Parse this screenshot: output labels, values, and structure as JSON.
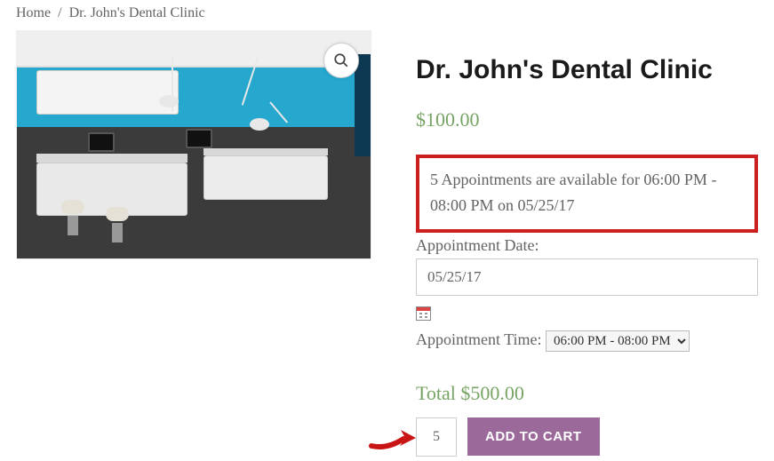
{
  "breadcrumb": {
    "home": "Home",
    "current": "Dr. John's Dental Clinic"
  },
  "product": {
    "title": "Dr. John's Dental Clinic",
    "price": "$100.00",
    "availability": "5 Appointments are available for 06:00 PM - 08:00 PM on 05/25/17",
    "date_label": "Appointment Date:",
    "date_value": "05/25/17",
    "time_label": "Appointment Time:",
    "time_value": "06:00 PM - 08:00 PM",
    "total_label": "Total",
    "total_value": "$500.00",
    "quantity": "5",
    "add_to_cart": "ADD TO CART"
  }
}
